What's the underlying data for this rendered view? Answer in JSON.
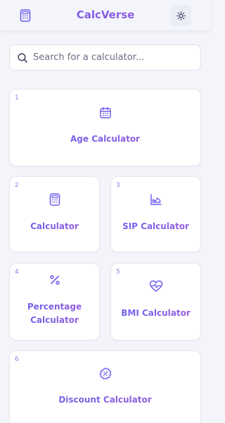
{
  "header": {
    "title": "CalcVerse",
    "logo_icon": "calculator-icon",
    "theme_icon": "sun-icon"
  },
  "search": {
    "placeholder": "Search for a calculator..."
  },
  "cards": [
    {
      "number": "1",
      "label": "Age Calculator",
      "icon": "calendar-icon"
    },
    {
      "number": "2",
      "label": "Calculator",
      "icon": "calculator-icon"
    },
    {
      "number": "3",
      "label": "SIP Calculator",
      "icon": "area-chart-icon"
    },
    {
      "number": "4",
      "label": "Percentage Calculator",
      "icon": "percent-icon"
    },
    {
      "number": "5",
      "label": "BMI Calculator",
      "icon": "heart-pulse-icon"
    },
    {
      "number": "6",
      "label": "Discount Calculator",
      "icon": "badge-percent-icon"
    }
  ],
  "colors": {
    "accent": "#6d5df0",
    "accent_end": "#a35bd9",
    "background": "#f4f5fa",
    "card": "#ffffff"
  }
}
